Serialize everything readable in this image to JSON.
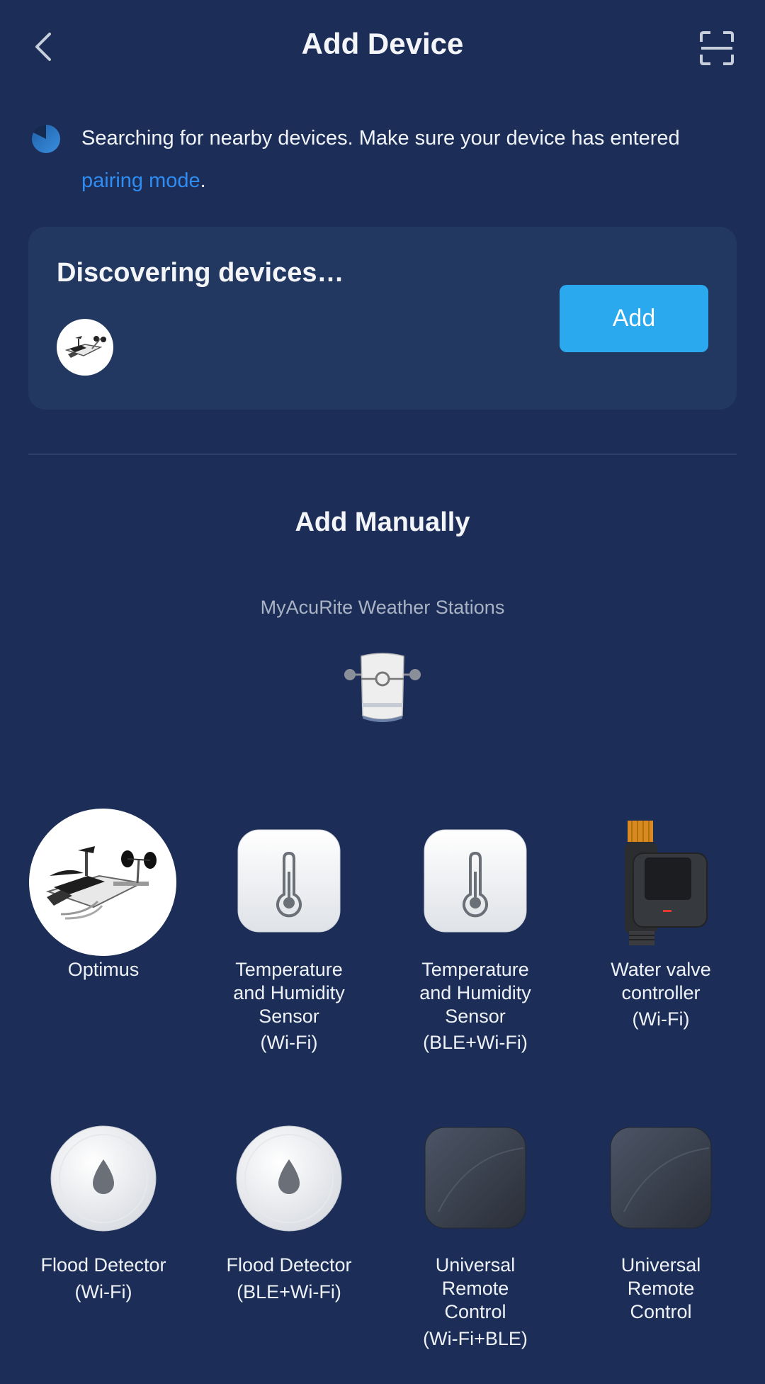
{
  "header": {
    "title": "Add Device",
    "back_icon": "chevron-left-icon",
    "scan_icon": "scan-frame-icon"
  },
  "search": {
    "text": "Searching for nearby devices. Make sure your device has entered ",
    "link_text": "pairing mode",
    "suffix": "."
  },
  "discover": {
    "title": "Discovering devices…",
    "add_label": "Add"
  },
  "manual": {
    "title": "Add Manually",
    "category": "MyAcuRite Weather Stations"
  },
  "devices": [
    {
      "name": "Optimus",
      "sub": ""
    },
    {
      "name": "Temperature\nand Humidity\nSensor",
      "sub": "(Wi-Fi)"
    },
    {
      "name": "Temperature\nand Humidity\nSensor",
      "sub": "(BLE+Wi-Fi)"
    },
    {
      "name": "Water valve\ncontroller",
      "sub": "(Wi-Fi)"
    },
    {
      "name": "Flood Detector",
      "sub": "(Wi-Fi)"
    },
    {
      "name": "Flood Detector",
      "sub": "(BLE+Wi-Fi)"
    },
    {
      "name": "Universal\nRemote\nControl",
      "sub": "(Wi-Fi+BLE)"
    },
    {
      "name": "Universal\nRemote\nControl",
      "sub": ""
    }
  ],
  "colors": {
    "background": "#1c2e57",
    "card": "#233861",
    "accent": "#2aa9ee",
    "link": "#2f8cf2"
  }
}
